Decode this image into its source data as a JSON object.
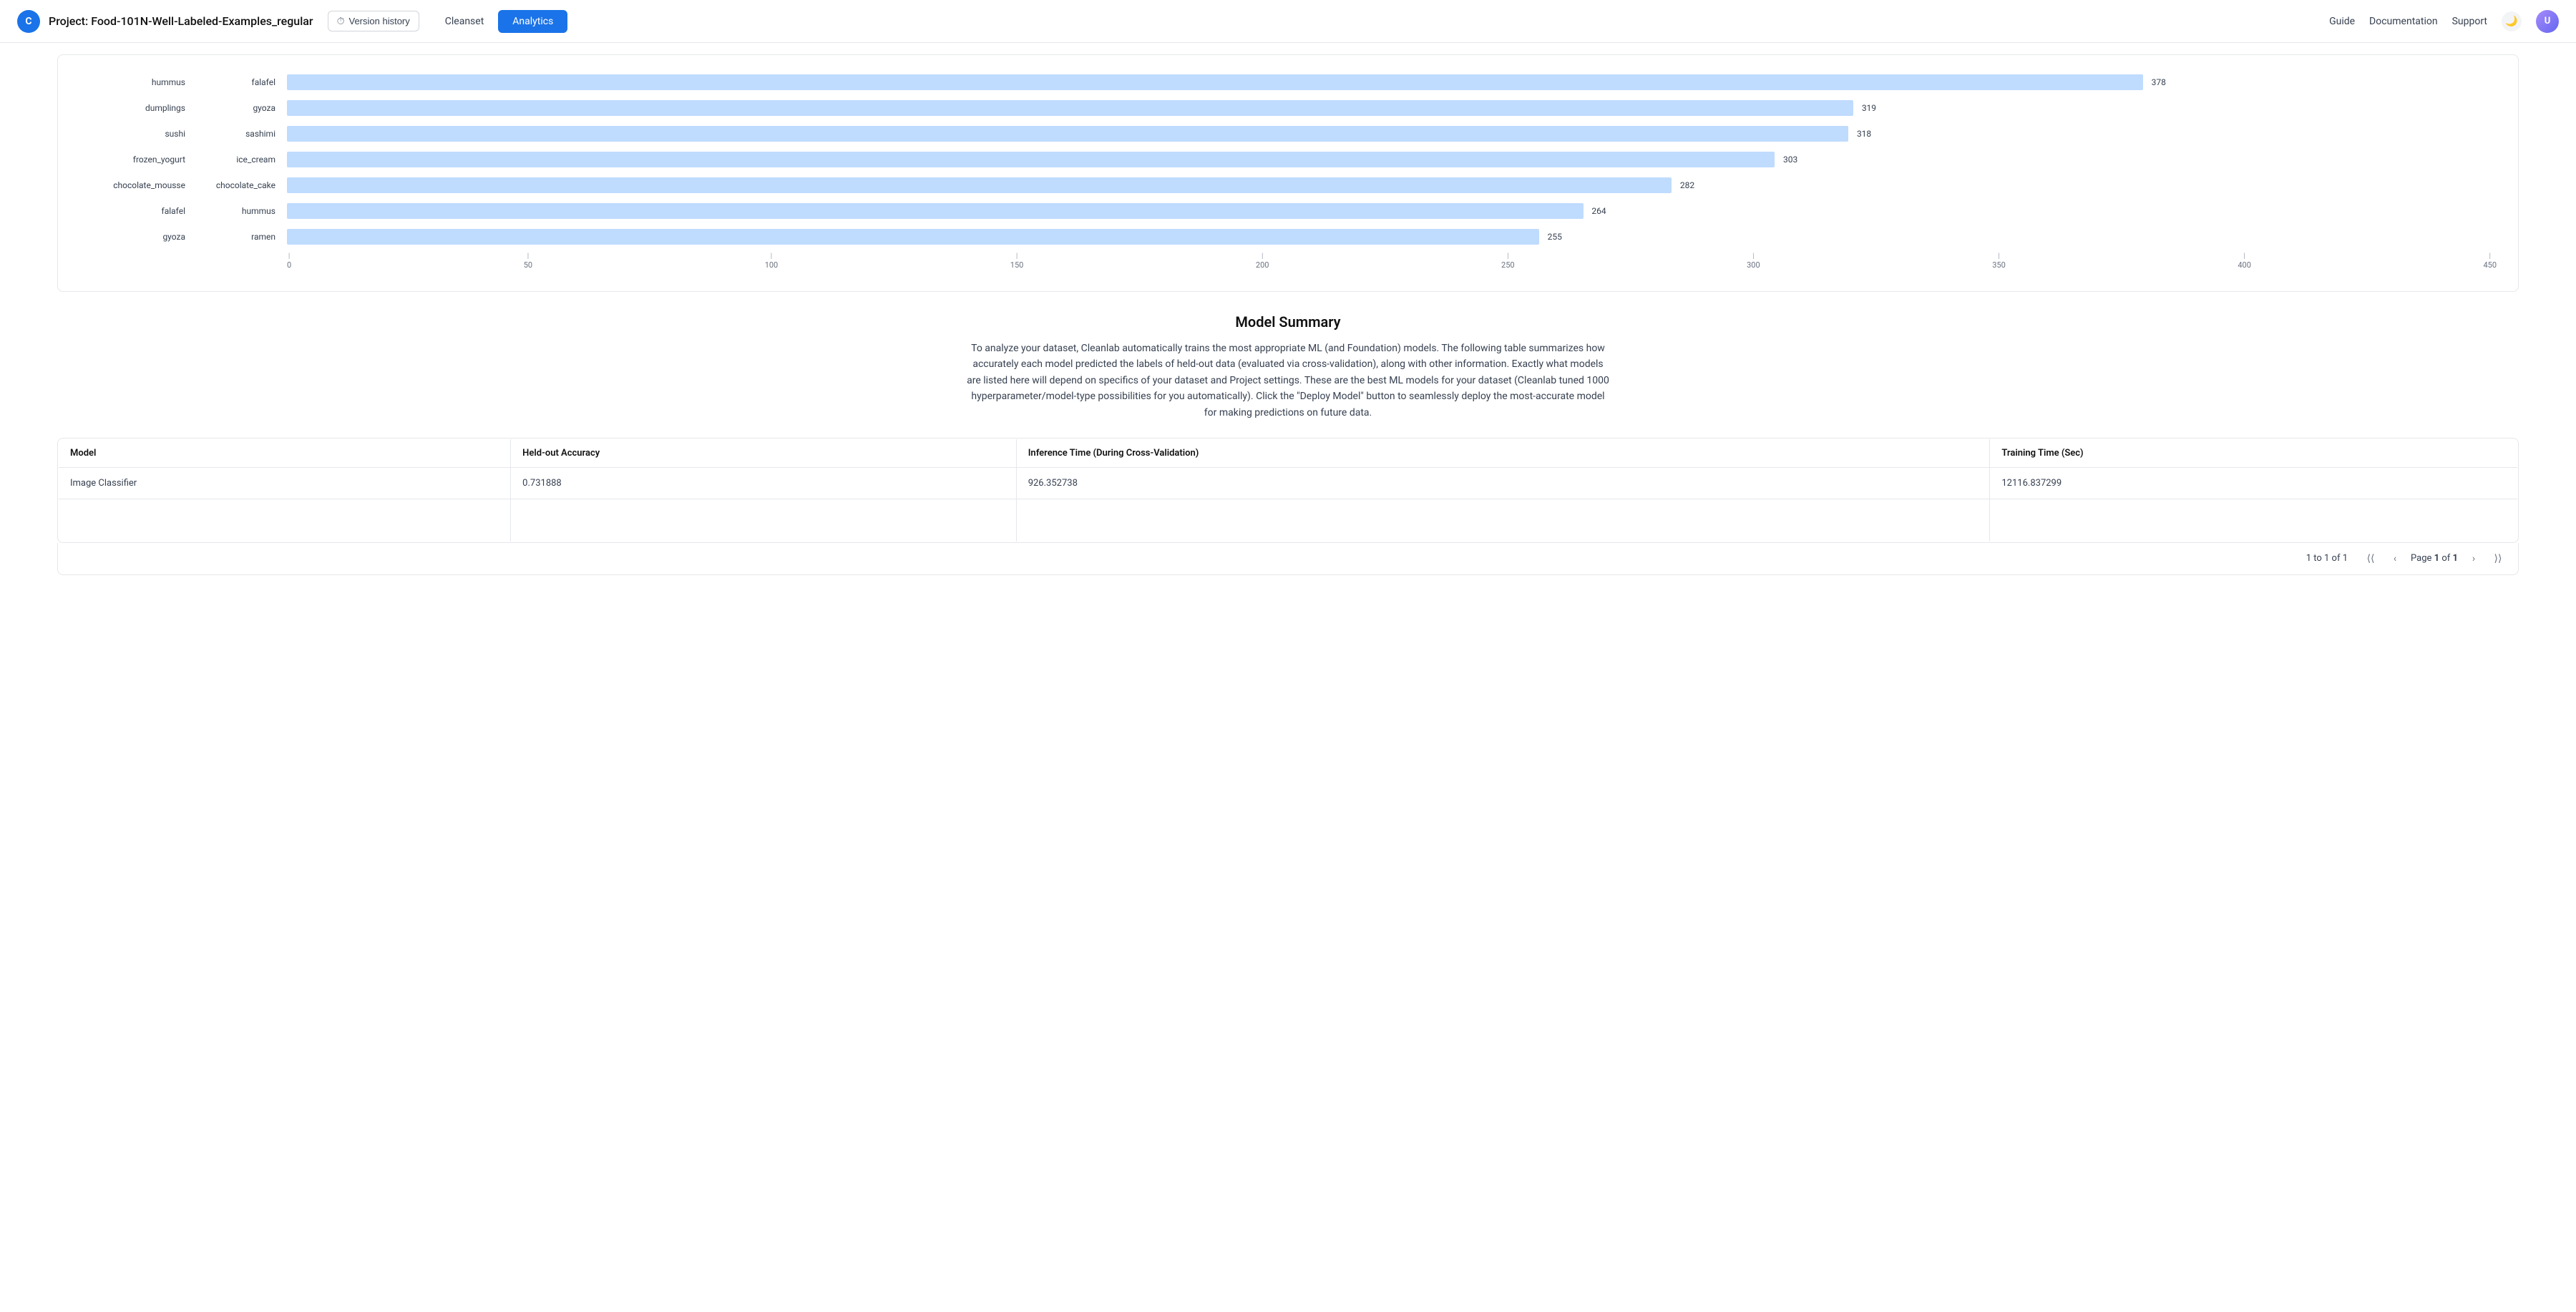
{
  "header": {
    "logo_text": "C",
    "project_name": "Project: Food-101N-Well-Labeled-Examples_regular",
    "version_history_label": "Version history",
    "tabs": [
      {
        "id": "cleanset",
        "label": "Cleanset",
        "active": false
      },
      {
        "id": "analytics",
        "label": "Analytics",
        "active": true
      }
    ],
    "nav_links": [
      "Guide",
      "Documentation",
      "Support"
    ],
    "dark_mode_icon": "🌙"
  },
  "chart": {
    "rows": [
      {
        "left_label": "hummus",
        "right_label": "falafel",
        "value": 378,
        "max": 450
      },
      {
        "left_label": "dumplings",
        "right_label": "gyoza",
        "value": 319,
        "max": 450
      },
      {
        "left_label": "sushi",
        "right_label": "sashimi",
        "value": 318,
        "max": 450
      },
      {
        "left_label": "frozen_yogurt",
        "right_label": "ice_cream",
        "value": 303,
        "max": 450
      },
      {
        "left_label": "chocolate_mousse",
        "right_label": "chocolate_cake",
        "value": 282,
        "max": 450
      },
      {
        "left_label": "falafel",
        "right_label": "hummus",
        "value": 264,
        "max": 450
      },
      {
        "left_label": "gyoza",
        "right_label": "ramen",
        "value": 255,
        "max": 450
      }
    ],
    "axis_ticks": [
      "0",
      "50",
      "100",
      "150",
      "200",
      "250",
      "300",
      "350",
      "400",
      "450"
    ]
  },
  "model_summary": {
    "title": "Model Summary",
    "description": "To analyze your dataset, Cleanlab automatically trains the most appropriate ML (and Foundation) models. The following table summarizes how accurately each model predicted the labels of held-out data (evaluated via cross-validation), along with other information. Exactly what models are listed here will depend on specifics of your dataset and Project settings. These are the best ML models for your dataset (Cleanlab tuned 1000 hyperparameter/model-type possibilities for you automatically). Click the \"Deploy Model\" button to seamlessly deploy the most-accurate model for making predictions on future data.",
    "table": {
      "columns": [
        "Model",
        "Held-out Accuracy",
        "Inference Time (During Cross-Validation)",
        "Training Time (Sec)"
      ],
      "rows": [
        {
          "model": "Image Classifier",
          "accuracy": "0.731888",
          "inference_time": "926.352738",
          "training_time": "12116.837299"
        }
      ]
    }
  },
  "pagination": {
    "range_text": "1 to 1 of 1",
    "page_label": "Page",
    "page_current": "1",
    "page_of": "of",
    "page_total": "1"
  }
}
